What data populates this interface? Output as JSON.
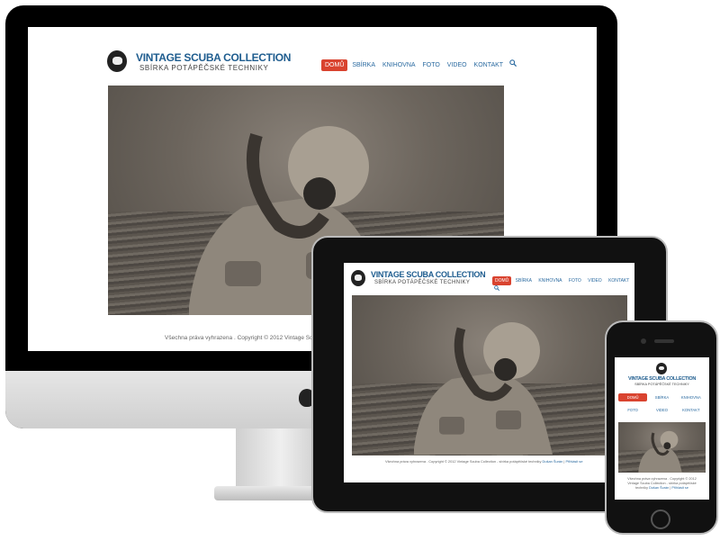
{
  "site": {
    "title": "VINTAGE SCUBA COLLECTION",
    "subtitle": "SBÍRKA POTÁPĚČSKÉ TECHNIKY",
    "nav": [
      "DOMŮ",
      "SBÍRKA",
      "KNIHOVNA",
      "FOTO",
      "VIDEO",
      "KONTAKT"
    ],
    "search_icon": "search-icon",
    "accent_color": "#d9432f",
    "link_color": "#2a6aa0",
    "logo_color": "#1f5d8f"
  },
  "imac": {
    "footer_text": "Všechna práva vyhrazena . Copyright © 2012 Vintage Scuba Collec"
  },
  "ipad": {
    "footer_text": "Všechna práva vyhrazena . Copyright © 2012 Vintage Scuba Collection - sbírka potápěčské techniky",
    "footer_link_1": "Dušan Šurán",
    "footer_sep": "|",
    "footer_link_2": "Přihlásit se"
  },
  "iphone": {
    "footer_line_1": "Všechna práva vyhrazena . Copyright © 2012",
    "footer_line_2": "Vintage Scuba Collection - sbírka potápěčské",
    "footer_line_3": "techniky",
    "footer_link_1": "Dušan Šurán",
    "footer_sep": "|",
    "footer_link_2": "Přihlásit se"
  }
}
